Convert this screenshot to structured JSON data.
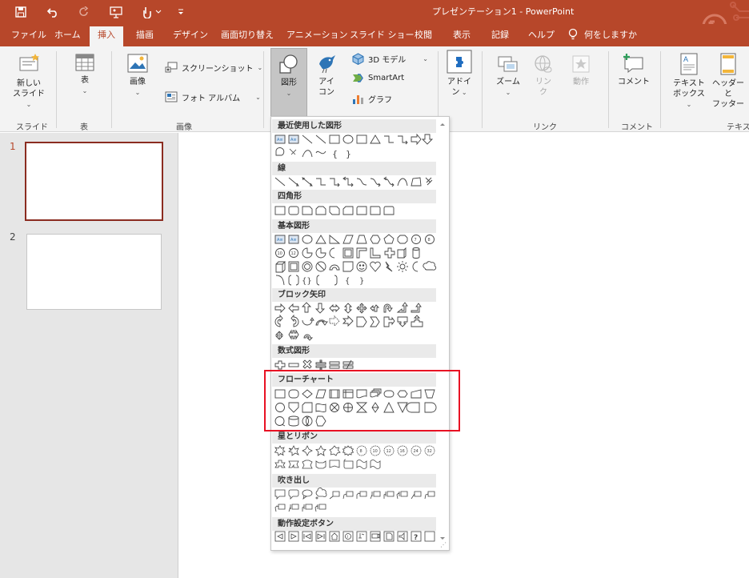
{
  "titlebar": {
    "title": "プレゼンテーション1  -  PowerPoint",
    "qat_icons": [
      "save-icon",
      "undo-icon",
      "redo-icon",
      "present-icon",
      "touch-mode-icon",
      "customize-icon"
    ]
  },
  "tabs": [
    "ファイル",
    "ホーム",
    "挿入",
    "描画",
    "デザイン",
    "画面切り替え",
    "アニメーション",
    "スライド ショー",
    "校閲",
    "表示",
    "記録",
    "ヘルプ"
  ],
  "active_tab": "挿入",
  "tell_me": "何をしますか",
  "ribbon": {
    "slides": {
      "new_slide": "新しい\nスライド",
      "label": "スライド"
    },
    "table": {
      "table": "表",
      "label": "表"
    },
    "images": {
      "picture": "画像",
      "screenshot": "スクリーンショット",
      "photo_album": "フォト アルバム",
      "label": "画像"
    },
    "illustrations": {
      "shapes": "図形",
      "icons": "アイ\nコン",
      "model3d": "3D モデル",
      "smartart": "SmartArt",
      "chart": "グラフ"
    },
    "addins": {
      "addins": "アドイ\nン"
    },
    "links": {
      "zoom": "ズーム",
      "link": "リン\nク",
      "action": "動作",
      "label": "リンク"
    },
    "comments": {
      "comment": "コメント",
      "label": "コメント"
    },
    "text": {
      "textbox": "テキスト\nボックス",
      "header_footer": "ヘッダーと\nフッター",
      "label": "テキス"
    }
  },
  "slides": [
    {
      "number": "1",
      "selected": true
    },
    {
      "number": "2",
      "selected": false
    }
  ],
  "shapes_menu": {
    "categories": [
      "最近使用した図形",
      "線",
      "四角形",
      "基本図形",
      "ブロック矢印",
      "数式図形",
      "フローチャート",
      "星とリボン",
      "吹き出し",
      "動作設定ボタン"
    ]
  },
  "colors": {
    "accent": "#B7472A",
    "selected_slide": "#8B2C20",
    "highlight": "#E81123"
  }
}
